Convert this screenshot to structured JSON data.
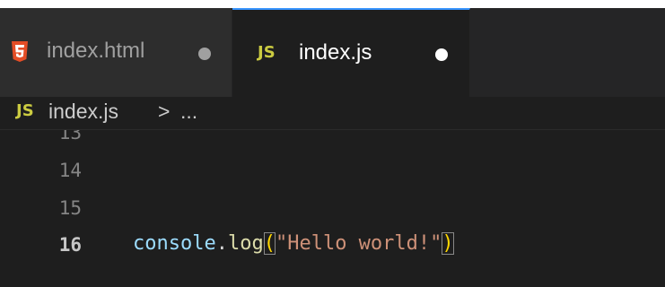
{
  "tabs": [
    {
      "icon": "html5-icon",
      "label": "index.html",
      "modified": true,
      "active": false
    },
    {
      "icon": "js-icon",
      "icon_text": "JS",
      "label": "index.js",
      "modified": true,
      "active": true
    }
  ],
  "breadcrumb": {
    "icon_text": "JS",
    "file": "index.js",
    "separator": ">",
    "more": "..."
  },
  "editor": {
    "lines": [
      {
        "number": "13",
        "active": false
      },
      {
        "number": "14",
        "active": false
      },
      {
        "number": "15",
        "active": false
      },
      {
        "number": "16",
        "active": true
      }
    ],
    "code": {
      "object": "console",
      "dot": ".",
      "method": "log",
      "open_paren": "(",
      "string": "\"Hello world!\"",
      "close_paren": ")"
    }
  },
  "colors": {
    "editor_bg": "#1e1e1e",
    "active_tab_border": "#3794ff",
    "js_icon": "#cbcb41",
    "html_icon": "#e44d26",
    "string": "#ce9178",
    "method": "#dcdcaa",
    "object": "#9cdcfe",
    "bracket": "#ffd700"
  }
}
